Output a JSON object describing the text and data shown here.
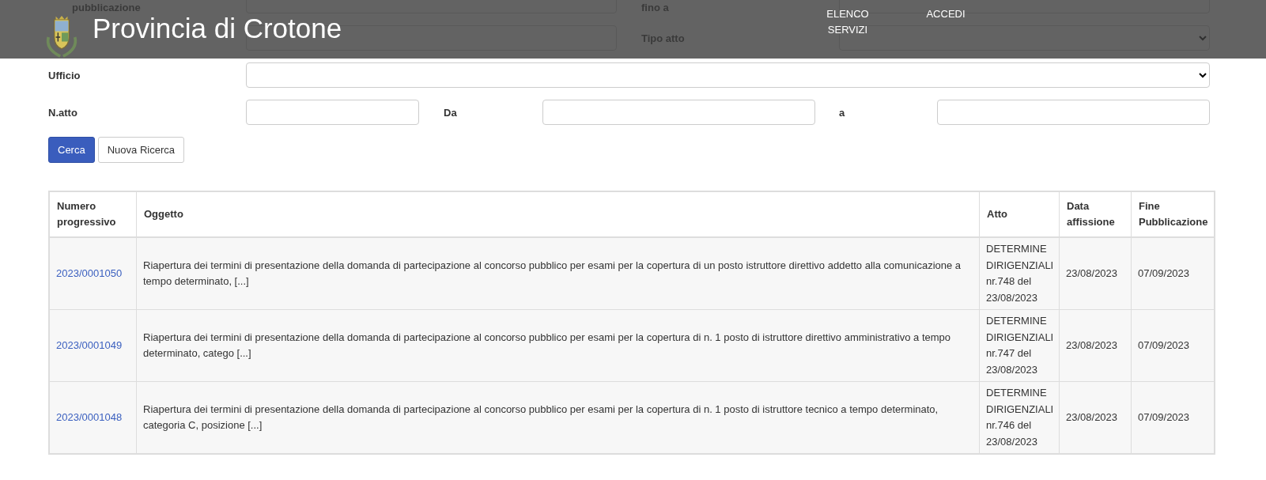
{
  "header": {
    "title": "Provincia di Crotone",
    "nav": [
      {
        "label": "ELENCO SERVIZI"
      },
      {
        "label": "ACCEDI"
      }
    ]
  },
  "form": {
    "rows": [
      {
        "kind": "pair",
        "fields": [
          {
            "label": "pubblicazione",
            "kind": "input"
          },
          {
            "label": "fino a",
            "kind": "input"
          }
        ]
      },
      {
        "kind": "pair",
        "fields": [
          {
            "kind": "input"
          },
          {
            "label": "Tipo atto",
            "kind": "select"
          }
        ]
      },
      {
        "kind": "single",
        "fields": [
          {
            "label": "Ufficio",
            "kind": "select"
          }
        ]
      },
      {
        "kind": "triple",
        "fields": [
          {
            "label": "N.atto",
            "kind": "input"
          },
          {
            "label": "Da",
            "kind": "input"
          },
          {
            "label": "a",
            "kind": "input"
          }
        ]
      }
    ],
    "buttons": [
      {
        "label": "Cerca",
        "kind": "primary"
      },
      {
        "label": "Nuova Ricerca",
        "kind": "default"
      }
    ]
  },
  "table": {
    "columns": [
      "Numero progressivo",
      "Oggetto",
      "Atto",
      "Data affissione",
      "Fine Pubblicazione"
    ],
    "rows": [
      {
        "numero": "2023/0001050",
        "oggetto": "Riapertura dei termini di presentazione della domanda di partecipazione al concorso pubblico per esami per la copertura di un posto istruttore direttivo addetto alla comunicazione a tempo determinato, [...]",
        "atto": "DETERMINE DIRIGENZIALI nr.748 del 23/08/2023",
        "data_affissione": "23/08/2023",
        "fine_pubblicazione": "07/09/2023"
      },
      {
        "numero": "2023/0001049",
        "oggetto": "Riapertura dei termini di presentazione della domanda di partecipazione al concorso pubblico per esami per la copertura di n. 1 posto di istruttore direttivo amministrativo a tempo determinato, catego [...]",
        "atto": "DETERMINE DIRIGENZIALI nr.747 del 23/08/2023",
        "data_affissione": "23/08/2023",
        "fine_pubblicazione": "07/09/2023"
      },
      {
        "numero": "2023/0001048",
        "oggetto": "Riapertura dei termini di presentazione della domanda di partecipazione al concorso pubblico per esami per la copertura di n. 1 posto di istruttore tecnico a tempo determinato, categoria C, posizione [...]",
        "atto": "DETERMINE DIRIGENZIALI nr.746 del 23/08/2023",
        "data_affissione": "23/08/2023",
        "fine_pubblicazione": "07/09/2023"
      }
    ]
  }
}
